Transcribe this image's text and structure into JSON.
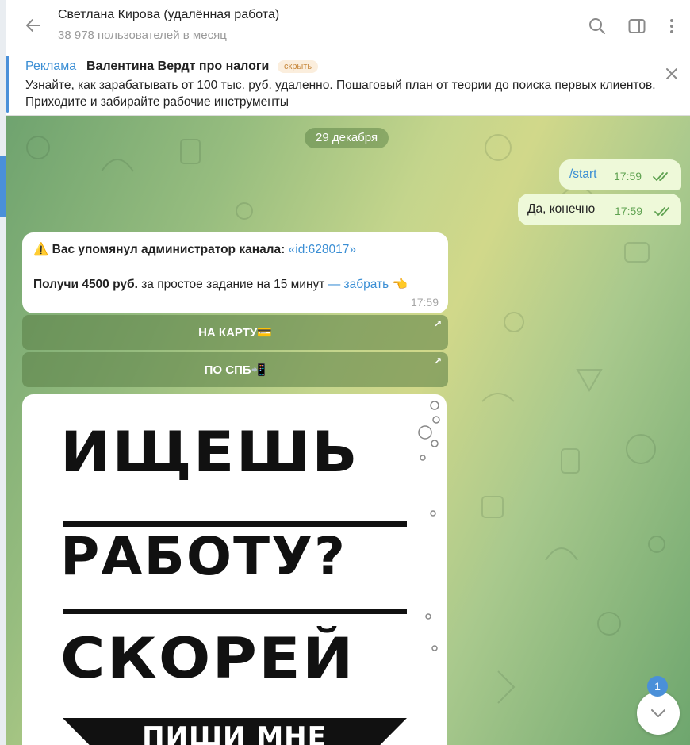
{
  "header": {
    "title": "Светлана Кирова (удалённая работа)",
    "subtitle": "38 978 пользователей в месяц",
    "icons": [
      "back-arrow-icon",
      "search-icon",
      "sidebar-toggle-icon",
      "more-vertical-icon"
    ]
  },
  "ad": {
    "label": "Реклама",
    "title": "Валентина Вердт про налоги",
    "hide": "скрыть",
    "text": "Узнайте, как зарабатывать от 100 тыс. руб. удаленно. Пошаговый план от теории до поиска первых клиентов. Приходите и забирайте рабочие инструменты"
  },
  "chat": {
    "date": "29 декабря",
    "outgoing": [
      {
        "text": "/start",
        "time": "17:59"
      },
      {
        "text": "Да, конечно",
        "time": "17:59"
      }
    ],
    "incoming": {
      "warning_emoji": "⚠️",
      "line1_bold": "Вас упомянул администратор канала:",
      "line1_link": "«id:628017»",
      "line2_bold": "Получи 4500 руб.",
      "line2_text": "за простое задание на 15 минут",
      "line2_link": "— забрать",
      "line2_emoji": "👈",
      "time": "17:59"
    },
    "buttons": [
      {
        "label": "НА КАРТУ💳"
      },
      {
        "label": "ПО СПБ📲"
      }
    ],
    "photo": {
      "word1": "ИЩЕШЬ",
      "word2": "РАБОТУ?",
      "word3": "СКОРЕЙ",
      "banner": "ПИШИ МНЕ"
    },
    "unread_count": "1"
  }
}
